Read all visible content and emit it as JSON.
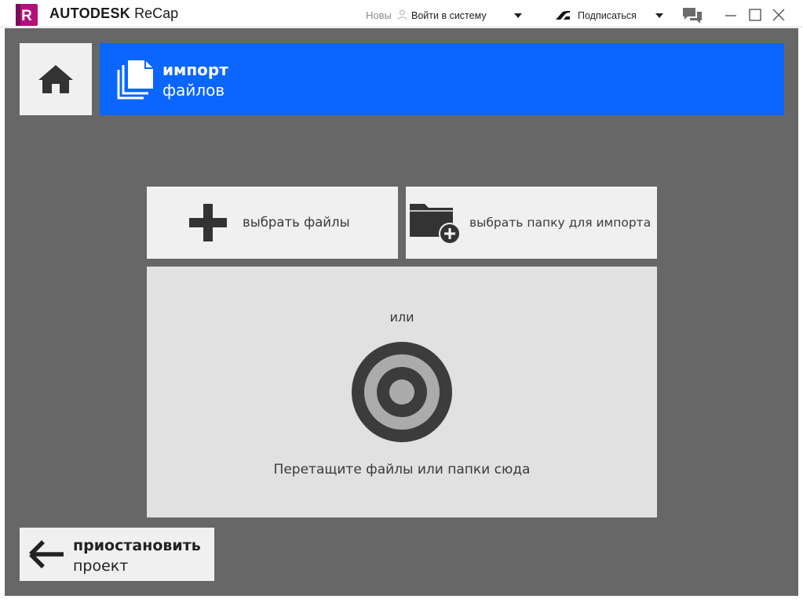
{
  "titlebar": {
    "logo_letter": "R",
    "brand": "AUTODESK",
    "product": "ReCap",
    "new_label": "Новы",
    "signin_label": "Войти в систему",
    "subscribe_label": "Подписаться",
    "colors": {
      "logo": "#b0127a"
    }
  },
  "header": {
    "title_line1": "импорт",
    "title_line2": "файлов",
    "icon": "files-stack-icon",
    "color": "#0a66ff"
  },
  "actions": {
    "select_files_label": "выбрать файлы",
    "select_folder_label": "выбрать папку для импорта"
  },
  "dropzone": {
    "or_label": "или",
    "drop_label": "Перетащите файлы или папки сюда"
  },
  "footer": {
    "back_line1": "приостановить",
    "back_line2": "проект"
  }
}
